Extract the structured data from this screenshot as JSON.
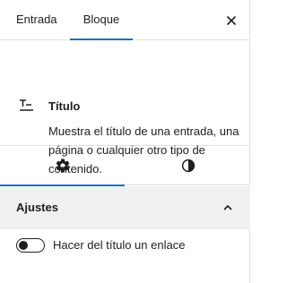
{
  "header": {
    "tabs": [
      {
        "label": "Entrada"
      },
      {
        "label": "Bloque"
      }
    ],
    "close_icon": "close-icon"
  },
  "block": {
    "icon": "title-icon",
    "title": "Título",
    "description": "Muestra el título de una entrada, una página o cualquier otro tipo de contenido."
  },
  "settings_tabs": [
    {
      "icon": "gear-icon"
    },
    {
      "icon": "contrast-icon"
    }
  ],
  "panel": {
    "title": "Ajustes",
    "chevron_icon": "chevron-up-icon",
    "toggle": {
      "label": "Hacer del título un enlace",
      "checked": false
    }
  },
  "colors": {
    "accent": "#1f72b9",
    "panel_bg": "#f0f0f0",
    "border": "#e0e0e0"
  }
}
